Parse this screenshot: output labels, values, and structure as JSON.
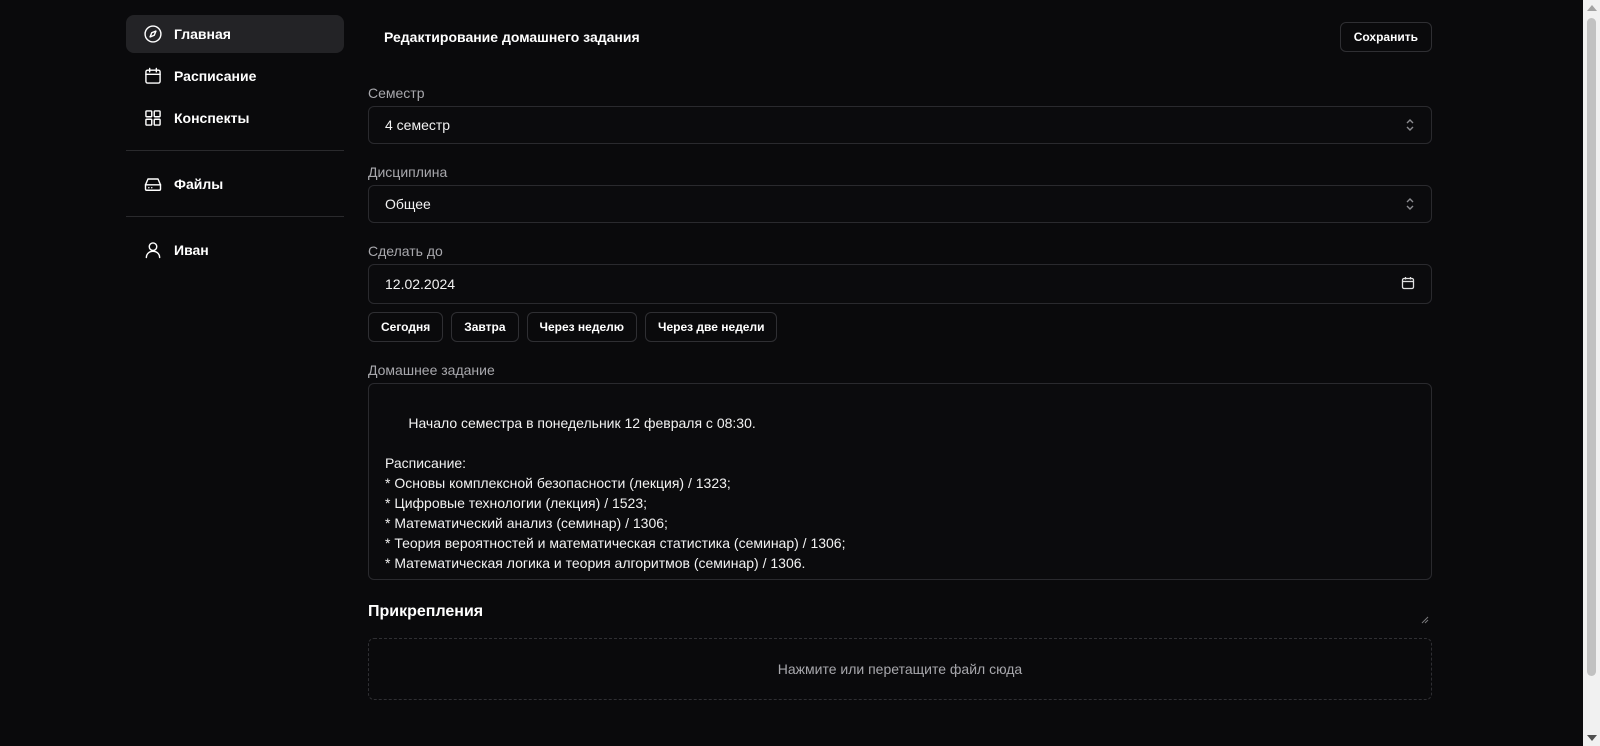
{
  "sidebar": {
    "items": [
      {
        "label": "Главная",
        "icon": "compass-icon",
        "active": true
      },
      {
        "label": "Расписание",
        "icon": "calendar-icon"
      },
      {
        "label": "Конспекты",
        "icon": "grid-icon"
      },
      {
        "label": "Файлы",
        "icon": "hard-drive-icon"
      },
      {
        "label": "Иван",
        "icon": "user-icon"
      }
    ]
  },
  "header": {
    "title": "Редактирование домашнего задания",
    "save_label": "Сохранить"
  },
  "form": {
    "semester": {
      "label": "Семестр",
      "value": "4 семестр"
    },
    "discipline": {
      "label": "Дисциплина",
      "value": "Общее"
    },
    "due": {
      "label": "Сделать до",
      "value": "12.02.2024"
    },
    "quick_dates": [
      "Сегодня",
      "Завтра",
      "Через неделю",
      "Через две недели"
    ],
    "homework": {
      "label": "Домашнее задание",
      "value": "Начало семестра в понедельник 12 февраля с 08:30.\n\nРасписание:\n* Основы комплексной безопасности (лекция) / 1323;\n* Цифровые технологии (лекция) / 1523;\n* Математический анализ (семинар) / 1306;\n* Теория вероятностей и математическая статистика (семинар) / 1306;\n* Математическая логика и теория алгоритмов (семинар) / 1306."
    }
  },
  "attachments": {
    "title": "Прикрепления",
    "dropzone_text": "Нажмите или перетащите файл сюда"
  },
  "colors": {
    "background": "#0a0a0c",
    "active_nav": "#232326",
    "border": "#2a2a2e"
  }
}
